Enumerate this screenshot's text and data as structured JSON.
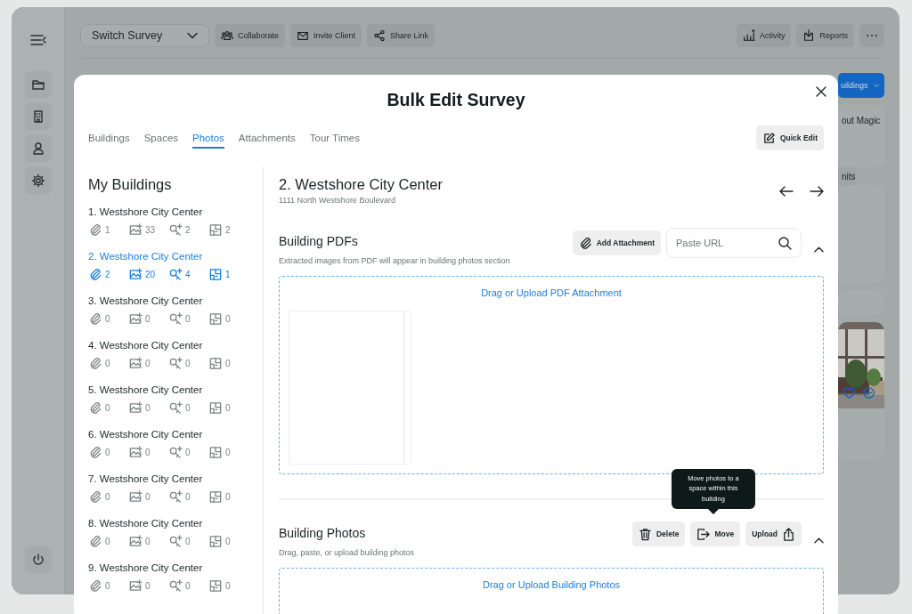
{
  "topbar": {
    "survey_select": "Switch Survey",
    "left_buttons": [
      "Collaborate",
      "Invite Client",
      "Share Link"
    ],
    "right_buttons": [
      "Activity",
      "Reports"
    ],
    "more": "⋯"
  },
  "background": {
    "buildings_button": "uildings",
    "card_texts": [
      "out Magic",
      "nits"
    ]
  },
  "modal": {
    "title": "Bulk Edit Survey",
    "tabs": [
      {
        "label": "Buildings",
        "selected": false
      },
      {
        "label": "Spaces",
        "selected": false
      },
      {
        "label": "Photos",
        "selected": true
      },
      {
        "label": "Attachments",
        "selected": false
      },
      {
        "label": "Tour Times",
        "selected": false
      }
    ],
    "quick_edit": "Quick Edit",
    "buildings_heading": "My Buildings",
    "buildings": [
      {
        "name": "1. Westshore City Center",
        "selected": false,
        "attachments": "1",
        "photos": "33",
        "spaces": "2",
        "floorplans": "2"
      },
      {
        "name": "2. Westshore City Center",
        "selected": true,
        "attachments": "2",
        "photos": "20",
        "spaces": "4",
        "floorplans": "1"
      },
      {
        "name": "3. Westshore City Center",
        "selected": false,
        "attachments": "0",
        "photos": "0",
        "spaces": "0",
        "floorplans": "0"
      },
      {
        "name": "4. Westshore City Center",
        "selected": false,
        "attachments": "0",
        "photos": "0",
        "spaces": "0",
        "floorplans": "0"
      },
      {
        "name": "5. Westshore City Center",
        "selected": false,
        "attachments": "0",
        "photos": "0",
        "spaces": "0",
        "floorplans": "0"
      },
      {
        "name": "6. Westshore City Center",
        "selected": false,
        "attachments": "0",
        "photos": "0",
        "spaces": "0",
        "floorplans": "0"
      },
      {
        "name": "7. Westshore City Center",
        "selected": false,
        "attachments": "0",
        "photos": "0",
        "spaces": "0",
        "floorplans": "0"
      },
      {
        "name": "8. Westshore City Center",
        "selected": false,
        "attachments": "0",
        "photos": "0",
        "spaces": "0",
        "floorplans": "0"
      },
      {
        "name": "9. Westshore City Center",
        "selected": false,
        "attachments": "0",
        "photos": "0",
        "spaces": "0",
        "floorplans": "0"
      }
    ],
    "detail": {
      "title": "2. Westshore City Center",
      "address": "1111 North Westshore Boulevard"
    },
    "pdfs": {
      "heading": "Building PDFs",
      "description": "Extracted images from PDF will appear in building photos section",
      "add_attachment": "Add Attachment",
      "url_placeholder": "Paste URL",
      "expanded": true,
      "dropzone": "Drag or Upload PDF Attachment"
    },
    "photos": {
      "heading": "Building Photos",
      "description": "Drag, paste, or upload building photos",
      "buttons": [
        "Delete",
        "Move",
        "Upload"
      ],
      "tooltip": "Move photos to a space within this building",
      "expanded": true,
      "dropzone": "Drag or Upload Building Photos"
    }
  }
}
